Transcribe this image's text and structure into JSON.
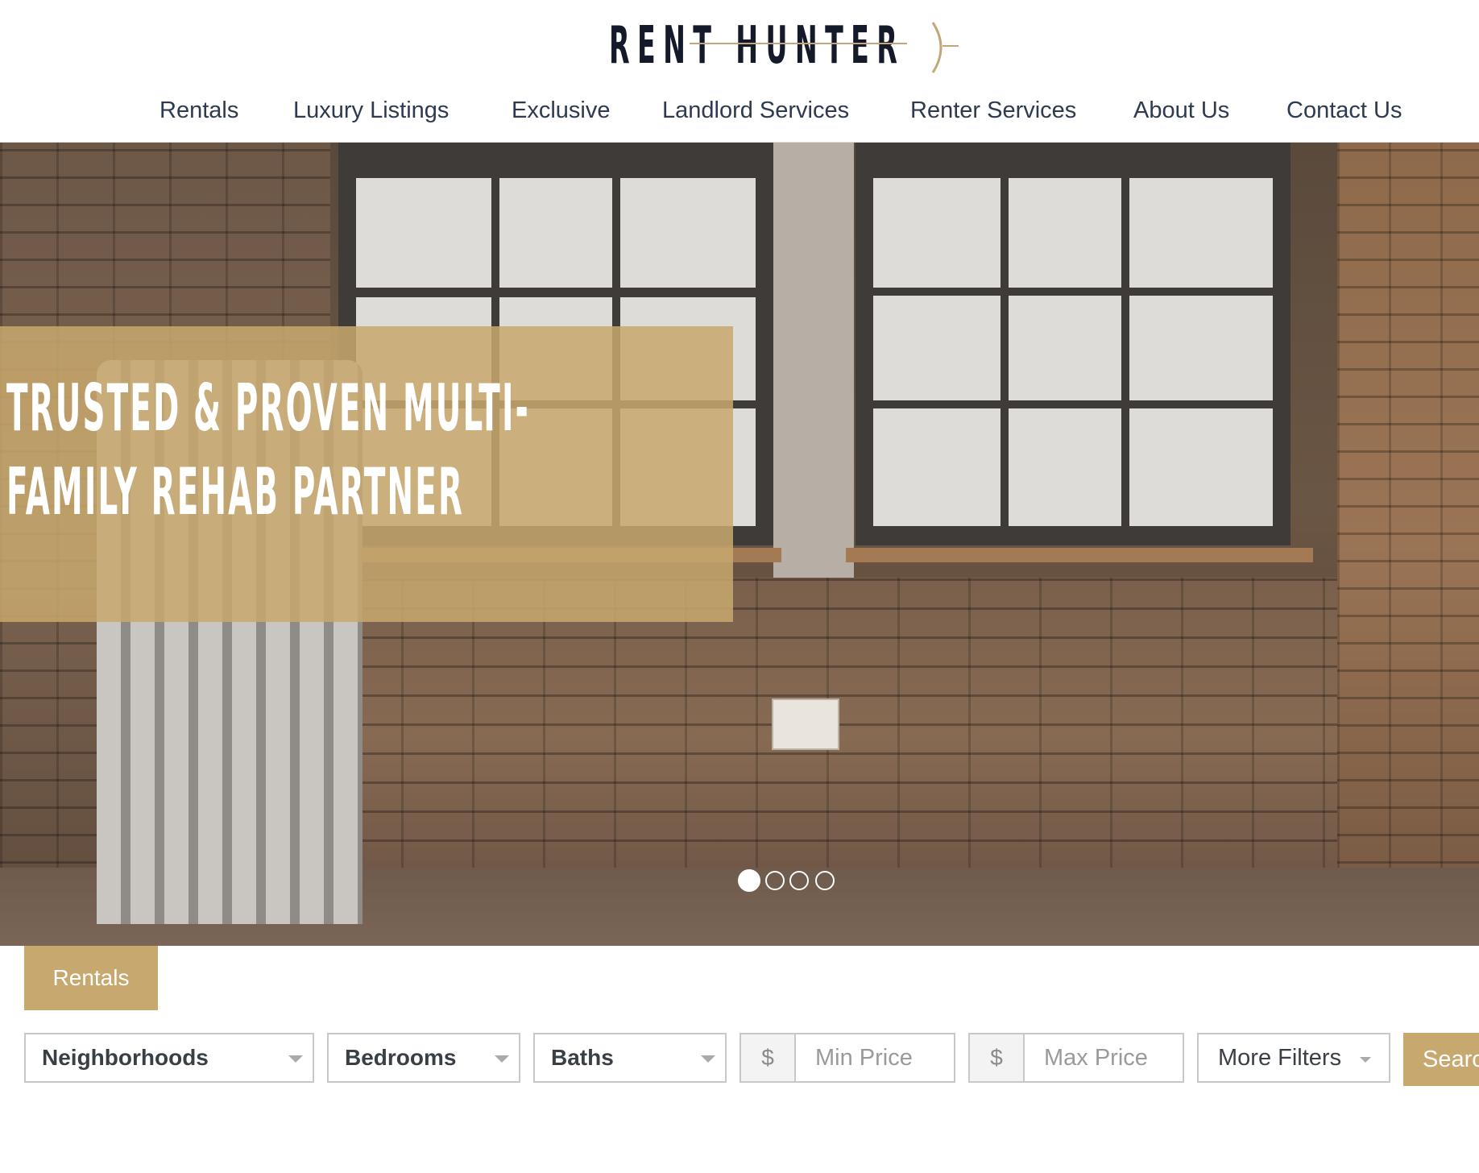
{
  "brand": {
    "logo_text": "RENT HUNTER"
  },
  "nav": {
    "items": [
      {
        "label": "Rentals"
      },
      {
        "label": "Luxury Listings"
      },
      {
        "label": "Exclusive"
      },
      {
        "label": "Landlord Services"
      },
      {
        "label": "Renter Services"
      },
      {
        "label": "About Us"
      },
      {
        "label": "Contact Us"
      }
    ]
  },
  "hero": {
    "title": "TRUSTED & PROVEN MULTI-FAMILY REHAB PARTNER",
    "slides_total": 4,
    "active_slide": 1
  },
  "search": {
    "tab_label": "Rentals",
    "neighborhoods_label": "Neighborhoods",
    "bedrooms_label": "Bedrooms",
    "baths_label": "Baths",
    "currency_symbol": "$",
    "min_price_placeholder": "Min Price",
    "max_price_placeholder": "Max Price",
    "more_filters_label": "More Filters",
    "search_button_label": "Search"
  },
  "colors": {
    "accent_gold": "#c7a86e",
    "nav_text": "#2d3a4f",
    "logo_text": "#141a2a"
  }
}
